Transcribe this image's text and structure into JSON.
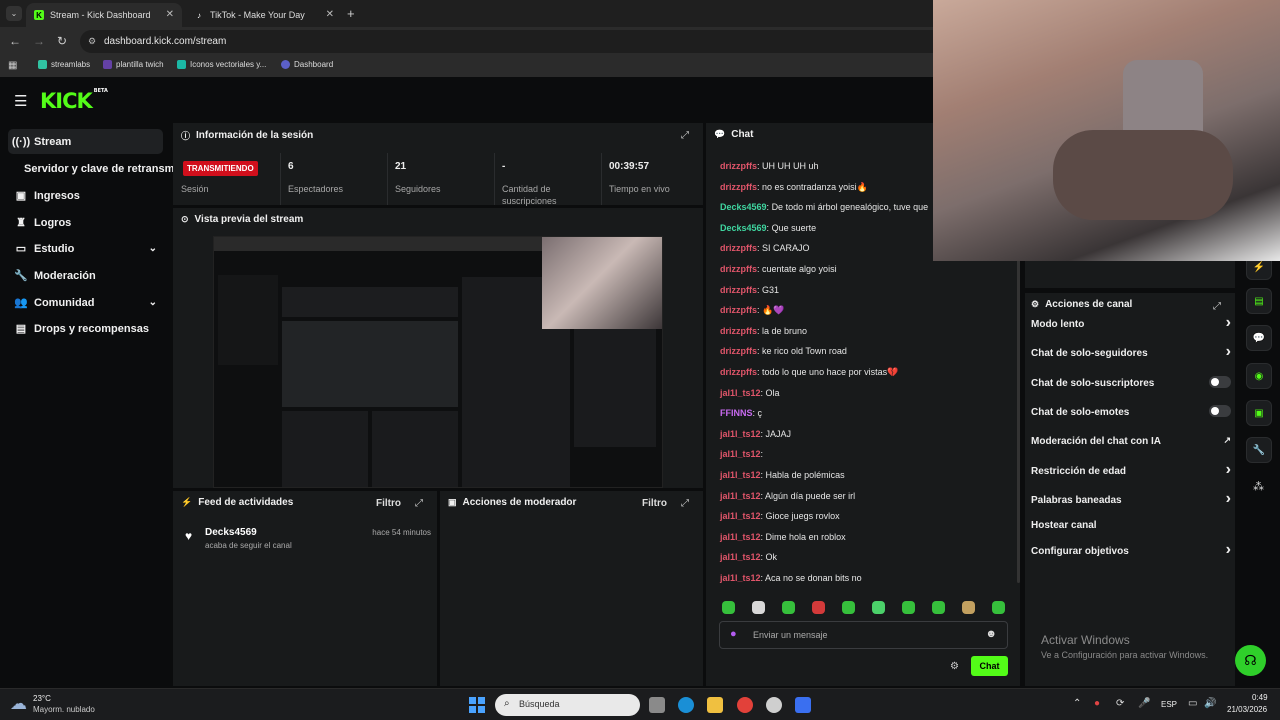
{
  "browser": {
    "tabs": [
      {
        "title": "Stream - Kick Dashboard",
        "active": true
      },
      {
        "title": "TikTok - Make Your Day",
        "active": false
      }
    ],
    "new_tab": "+",
    "url": "dashboard.kick.com/stream",
    "bookmarks": [
      "streamlabs",
      "plantilla twich",
      "Iconos vectoriales y...",
      "Dashboard"
    ]
  },
  "app": {
    "logo": "KICK",
    "logo_badge": "BETA",
    "sidebar": [
      {
        "label": "Stream",
        "icon": "broadcast-icon",
        "active": true
      },
      {
        "label": "Servidor y clave de retransm",
        "icon": "",
        "active": false
      },
      {
        "label": "Ingresos",
        "icon": "money-icon",
        "active": false
      },
      {
        "label": "Logros",
        "icon": "trophy-icon",
        "active": false
      },
      {
        "label": "Estudio",
        "icon": "studio-icon",
        "active": false,
        "chevron": true
      },
      {
        "label": "Moderación",
        "icon": "wrench-icon",
        "active": false
      },
      {
        "label": "Comunidad",
        "icon": "people-icon",
        "active": false,
        "chevron": true
      },
      {
        "label": "Drops y recompensas",
        "icon": "gift-icon",
        "active": false
      }
    ]
  },
  "session": {
    "title": "Información de la sesión",
    "status_badge": "TRANSMITIENDO",
    "stats": [
      {
        "value": "",
        "label": "Sesión"
      },
      {
        "value": "6",
        "label": "Espectadores"
      },
      {
        "value": "21",
        "label": "Seguidores"
      },
      {
        "value": "-",
        "label": "Cantidad de suscripciones"
      },
      {
        "value": "00:39:57",
        "label": "Tiempo en vivo"
      }
    ]
  },
  "preview": {
    "title": "Vista previa del stream"
  },
  "activity": {
    "title": "Feed de actividades",
    "filter": "Filtro",
    "items": [
      {
        "user": "Decks4569",
        "text": "acaba de seguir el canal",
        "time": "hace 54 minutos"
      }
    ]
  },
  "moderator": {
    "title": "Acciones de moderador",
    "filter": "Filtro"
  },
  "chat": {
    "title": "Chat",
    "messages": [
      {
        "user": "drizzpffs",
        "text": "UH UH UH uh",
        "color": "#e0556a"
      },
      {
        "user": "drizzpffs",
        "text": "no es contradanza yoisi🔥",
        "color": "#e0556a"
      },
      {
        "user": "Decks4569",
        "text": "De todo mi árbol genealógico, tuve que",
        "color": "#3fd6a0"
      },
      {
        "user": "Decks4569",
        "text": "Que suerte",
        "color": "#3fd6a0"
      },
      {
        "user": "drizzpffs",
        "text": "SI CARAJO",
        "color": "#e0556a"
      },
      {
        "user": "drizzpffs",
        "text": "cuentate algo yoisi",
        "color": "#e0556a"
      },
      {
        "user": "drizzpffs",
        "text": "G31",
        "color": "#e0556a"
      },
      {
        "user": "drizzpffs",
        "text": "🔥💜",
        "color": "#e0556a"
      },
      {
        "user": "drizzpffs",
        "text": "la de bruno",
        "color": "#e0556a"
      },
      {
        "user": "drizzpffs",
        "text": "ke rico old Town road",
        "color": "#e0556a"
      },
      {
        "user": "drizzpffs",
        "text": "todo lo que uno hace por vistas💔",
        "color": "#e0556a"
      },
      {
        "user": "jal1l_ts12",
        "text": "Ola",
        "color": "#e0556a"
      },
      {
        "user": "FFINNS",
        "text": "ç",
        "color": "#c86af0"
      },
      {
        "user": "jal1l_ts12",
        "text": "JAJAJ",
        "color": "#e0556a"
      },
      {
        "user": "jal1l_ts12",
        "text": "",
        "color": "#e0556a"
      },
      {
        "user": "jal1l_ts12",
        "text": "Habla de polémicas",
        "color": "#e0556a"
      },
      {
        "user": "jal1l_ts12",
        "text": "Algún día puede ser irl",
        "color": "#e0556a"
      },
      {
        "user": "jal1l_ts12",
        "text": "Gioce juegs rovlox",
        "color": "#e0556a"
      },
      {
        "user": "jal1l_ts12",
        "text": "Dime hola en roblox",
        "color": "#e0556a"
      },
      {
        "user": "jal1l_ts12",
        "text": "Ok",
        "color": "#e0556a"
      },
      {
        "user": "jal1l_ts12",
        "text": "Aca no se donan bits no",
        "color": "#e0556a"
      }
    ],
    "input_placeholder": "Enviar un mensaje",
    "send_label": "Chat"
  },
  "channel_actions": {
    "title": "Acciones de canal",
    "rows": [
      {
        "label": "Modo lento",
        "control": "chevron"
      },
      {
        "label": "Chat de solo-seguidores",
        "control": "chevron"
      },
      {
        "label": "Chat de solo-suscriptores",
        "control": "toggle"
      },
      {
        "label": "Chat de solo-emotes",
        "control": "toggle"
      },
      {
        "label": "Moderación del chat con IA",
        "control": "external"
      },
      {
        "label": "Restricción de edad",
        "control": "chevron"
      },
      {
        "label": "Palabras baneadas",
        "control": "chevron"
      },
      {
        "label": "Hostear canal",
        "control": "none"
      },
      {
        "label": "Configurar objetivos",
        "control": "chevron"
      }
    ]
  },
  "watermark": {
    "line1": "Activar Windows",
    "line2": "Ve a Configuración para activar Windows."
  },
  "taskbar": {
    "weather_temp": "23°C",
    "weather_desc": "Mayorm. nublado",
    "search_placeholder": "Búsqueda",
    "lang": "ESP",
    "time": "0:49",
    "date": "21/03/2026"
  },
  "colors": {
    "accent": "#53fc18",
    "live": "#d10f1c",
    "panel": "#181a1b"
  }
}
